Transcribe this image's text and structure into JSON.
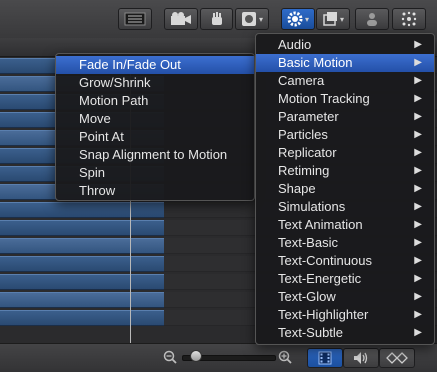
{
  "colors": {
    "accent": "#2f6bc8",
    "menu_bg": "#1a1a1c",
    "track_blue": "#3b5f8c"
  },
  "toolbar": {
    "buttons": [
      {
        "name": "inspector-toggle-icon"
      },
      {
        "name": "camera-icon"
      },
      {
        "name": "hand-icon"
      },
      {
        "name": "mask-icon"
      },
      {
        "name": "behaviors-gear-icon"
      },
      {
        "name": "layers-icon"
      },
      {
        "name": "person-icon"
      },
      {
        "name": "particles-icon"
      }
    ]
  },
  "behaviors_menu": {
    "items": [
      {
        "label": "Audio"
      },
      {
        "label": "Basic Motion"
      },
      {
        "label": "Camera"
      },
      {
        "label": "Motion Tracking"
      },
      {
        "label": "Parameter"
      },
      {
        "label": "Particles"
      },
      {
        "label": "Replicator"
      },
      {
        "label": "Retiming"
      },
      {
        "label": "Shape"
      },
      {
        "label": "Simulations"
      },
      {
        "label": "Text Animation"
      },
      {
        "label": "Text-Basic"
      },
      {
        "label": "Text-Continuous"
      },
      {
        "label": "Text-Energetic"
      },
      {
        "label": "Text-Glow"
      },
      {
        "label": "Text-Highlighter"
      },
      {
        "label": "Text-Subtle"
      }
    ],
    "highlighted": "Basic Motion"
  },
  "basic_motion_submenu": {
    "items": [
      {
        "label": "Fade In/Fade Out"
      },
      {
        "label": "Grow/Shrink"
      },
      {
        "label": "Motion Path"
      },
      {
        "label": "Move"
      },
      {
        "label": "Point At"
      },
      {
        "label": "Snap Alignment to Motion"
      },
      {
        "label": "Spin"
      },
      {
        "label": "Throw"
      }
    ],
    "highlighted": "Fade In/Fade Out"
  },
  "bottombar": {
    "zoom_slider_level": 0.1
  }
}
